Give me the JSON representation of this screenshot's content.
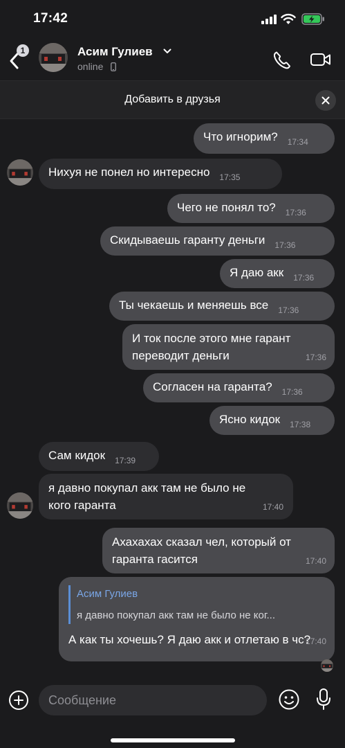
{
  "status_bar": {
    "time": "17:42"
  },
  "header": {
    "back_badge": "1",
    "contact_name": "Асим Гулиев",
    "status": "online"
  },
  "friend_banner": {
    "label": "Добавить в друзья"
  },
  "messages": [
    {
      "dir": "out",
      "text": "Что игнорим?",
      "time": "17:34"
    },
    {
      "dir": "in",
      "text": "Нихуя не понел но интересно",
      "time": "17:35"
    },
    {
      "dir": "out",
      "text": "Чего не понял то?",
      "time": "17:36"
    },
    {
      "dir": "out",
      "text": "Скидываешь гаранту деньги",
      "time": "17:36"
    },
    {
      "dir": "out",
      "text": "Я даю акк",
      "time": "17:36"
    },
    {
      "dir": "out",
      "text": "Ты чекаешь и меняешь все",
      "time": "17:36"
    },
    {
      "dir": "out",
      "text": "И ток после этого мне гарант переводит деньги",
      "time": "17:36"
    },
    {
      "dir": "out",
      "text": "Согласен на гаранта?",
      "time": "17:36"
    },
    {
      "dir": "out",
      "text": "Ясно кидок",
      "time": "17:38"
    },
    {
      "dir": "in",
      "text": "Сам кидок",
      "time": "17:39"
    },
    {
      "dir": "in",
      "text": "я давно покупал акк там не было не кого гаранта",
      "time": "17:40"
    },
    {
      "dir": "out",
      "text": "Ахахахах сказал чел, который от гаранта гасится",
      "time": "17:40"
    },
    {
      "dir": "out",
      "reply_name": "Асим Гулиев",
      "reply_text": "я давно покупал акк там не было не ког...",
      "text": "А как ты хочешь? Я даю акк и отлетаю в чс?",
      "time": "17:40"
    }
  ],
  "composer": {
    "placeholder": "Сообщение"
  },
  "colors": {
    "background": "#1b1b1d",
    "outgoing_bubble": "#4a4a4e",
    "incoming_bubble": "#2d2d30",
    "reply_accent": "#5b8fd6",
    "battery_charging": "#34c759"
  }
}
